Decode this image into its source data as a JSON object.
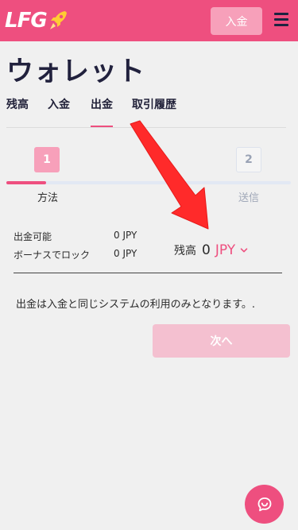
{
  "header": {
    "logo_text": "LFG",
    "deposit_label": "入金"
  },
  "page": {
    "title": "ウォレット"
  },
  "tabs": [
    {
      "label": "残高",
      "active": false
    },
    {
      "label": "入金",
      "active": false
    },
    {
      "label": "出金",
      "active": true
    },
    {
      "label": "取引履歴",
      "active": false
    }
  ],
  "stepper": {
    "steps": [
      {
        "number": "1",
        "label": "方法"
      },
      {
        "number": "2",
        "label": "送信"
      }
    ],
    "progress": 0.14
  },
  "info": {
    "withdrawable_label": "出金可能",
    "withdrawable_value": "0 JPY",
    "bonus_lock_label": "ボーナスでロック",
    "bonus_lock_value": "0 JPY",
    "balance_label": "残高",
    "balance_value": "0",
    "currency": "JPY"
  },
  "note": "出金は入金と同じシステムの利用のみとなります。.",
  "next_label": "次へ",
  "colors": {
    "brand": "#ee4f7f",
    "brand_light": "#f7a0ba",
    "disabled_button": "#f4c0d0",
    "background": "#f0f0f0",
    "title": "#21213d",
    "arrow": "#ff2a2a"
  },
  "icons": [
    "rocket-icon",
    "menu-icon",
    "chevron-down-icon",
    "chat-support-icon",
    "red-arrow-annotation"
  ]
}
